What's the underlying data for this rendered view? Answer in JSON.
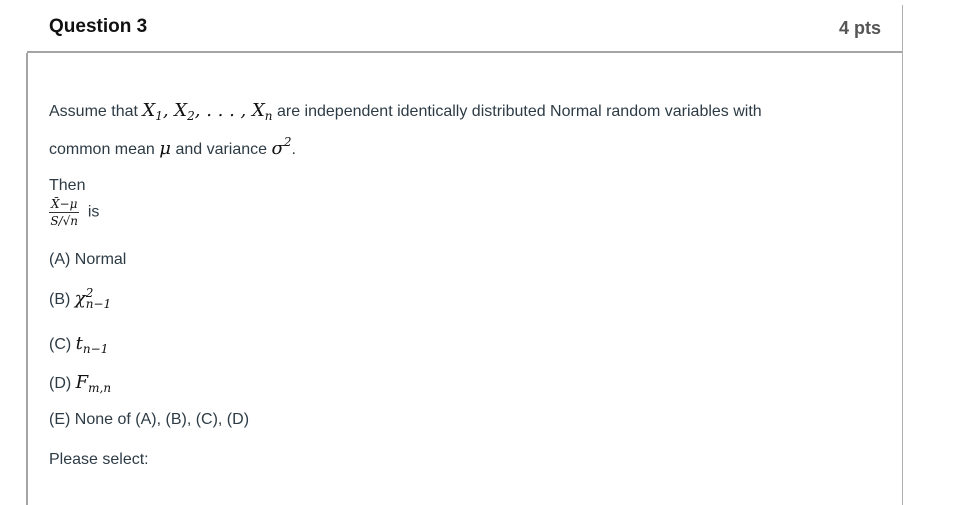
{
  "question": {
    "title": "Question 3",
    "points": "4 pts"
  },
  "body": {
    "intro_prefix": "Assume that",
    "variables": "X₁, X₂, . . . , Xₙ",
    "intro_middle": "are independent identically distributed Normal random variables with",
    "line2_prefix": "common mean",
    "mu": "μ",
    "line2_middle": "and variance",
    "sigma_sq": "σ²",
    "line2_suffix": ".",
    "then": "Then",
    "fraction_numerator": "X̄−μ",
    "fraction_denominator": "S/√n",
    "is": "is"
  },
  "options": [
    {
      "label": "(A)",
      "text": "Normal"
    },
    {
      "label": "(B)",
      "math": "χ",
      "sup": "2",
      "sub": "n−1"
    },
    {
      "label": "(C)",
      "math": "t",
      "sub": "n−1"
    },
    {
      "label": "(D)",
      "math": "F",
      "sub": "m,n"
    },
    {
      "label": "(E)",
      "text": "None of (A), (B), (C), (D)"
    }
  ],
  "select_prompt": "Please select:"
}
